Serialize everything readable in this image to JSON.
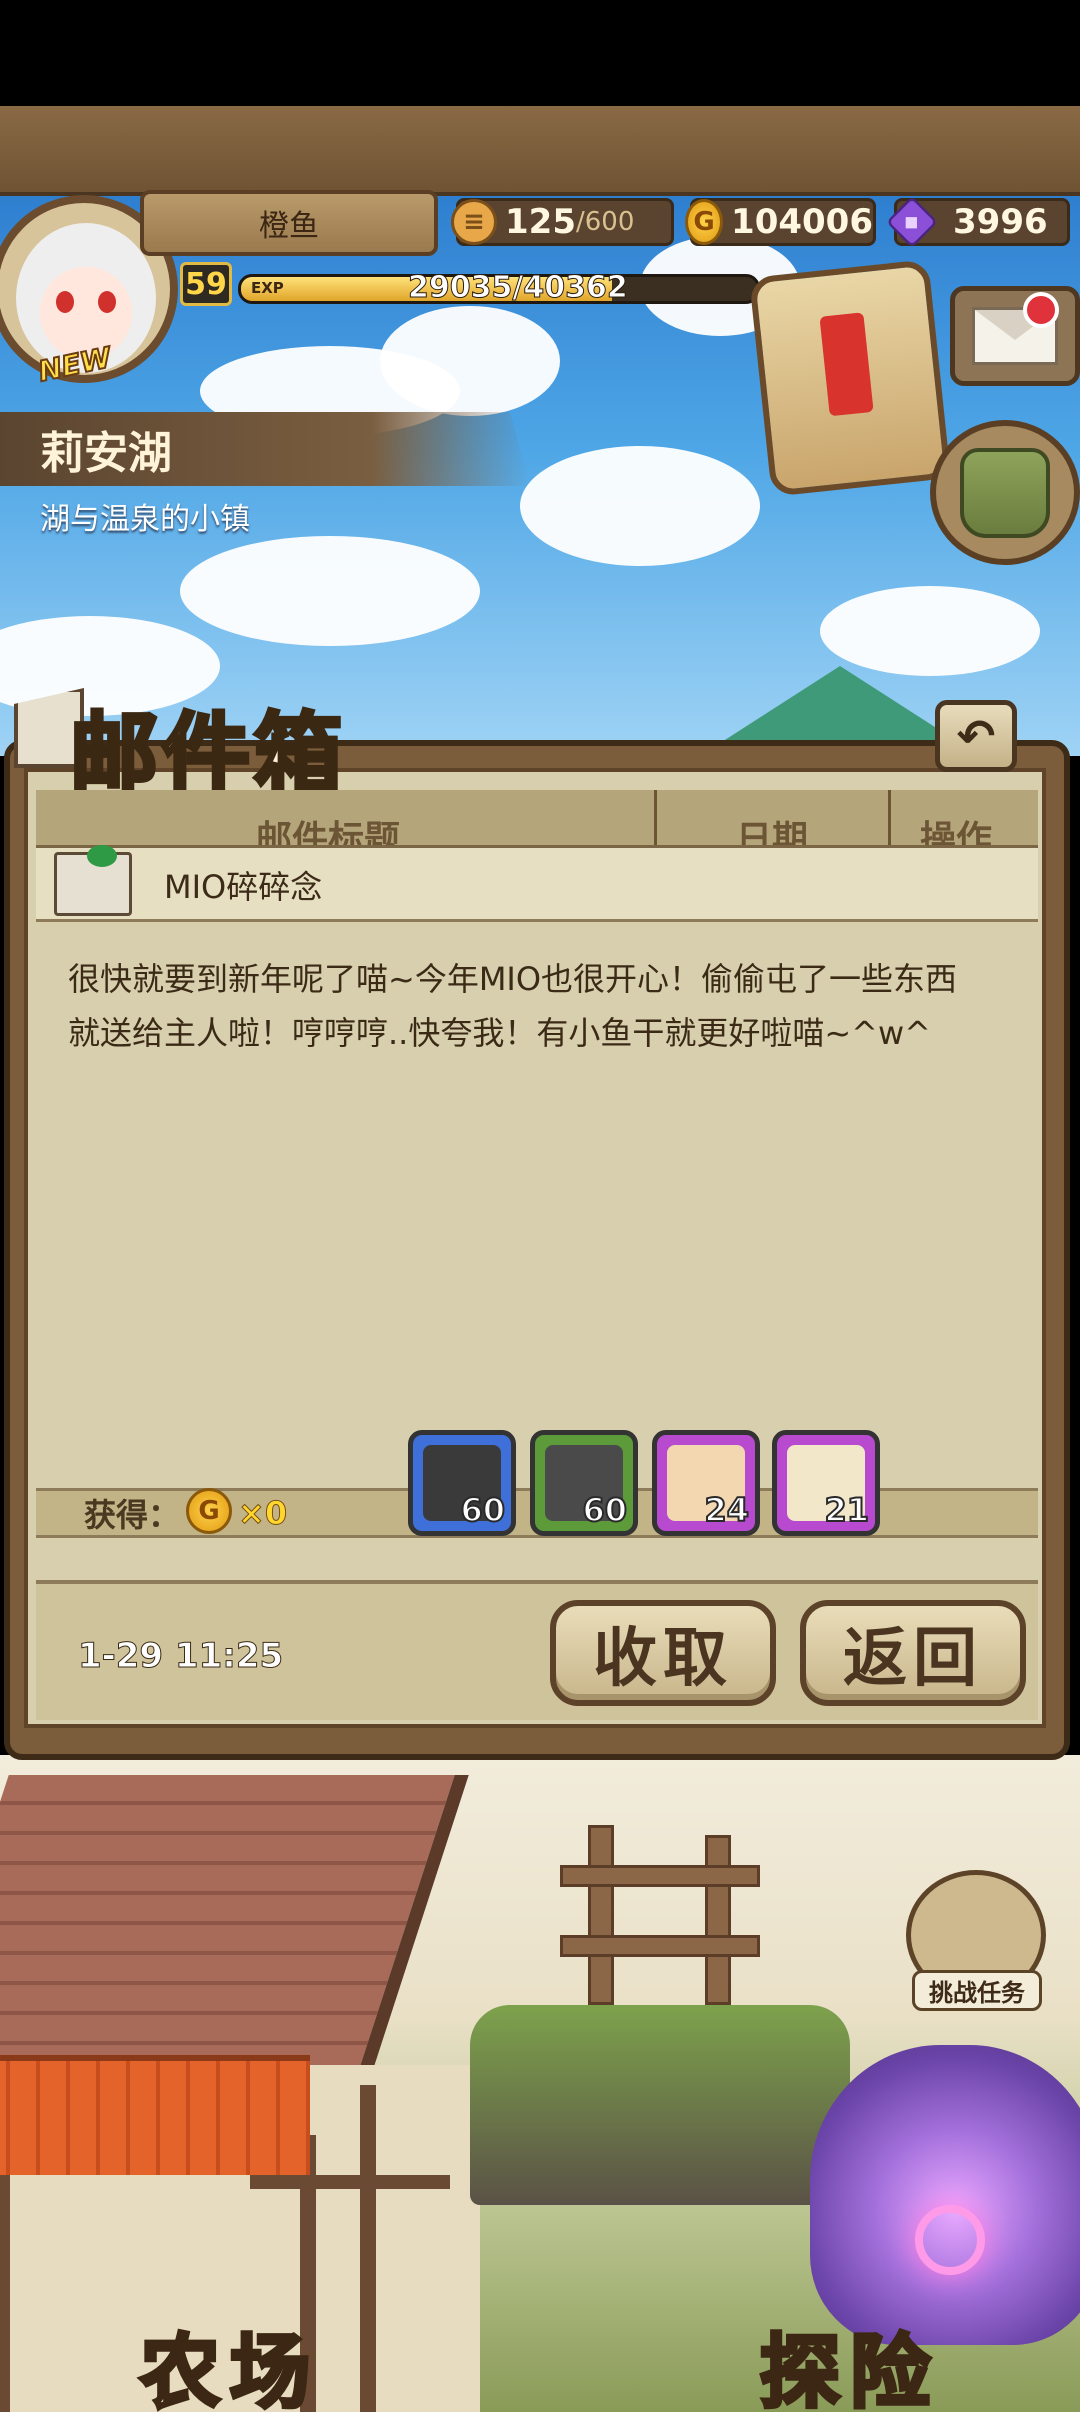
{
  "player": {
    "name": "橙鱼",
    "level": "59",
    "exp_label": "EXP",
    "exp_text": "29035/40362",
    "exp_fraction": 0.7194,
    "new_tag": "NEW"
  },
  "resources": {
    "stamina_value": "125",
    "stamina_max": "/600",
    "gold": "104006",
    "gems": "3996"
  },
  "location": {
    "name": "莉安湖",
    "subtitle": "湖与温泉的小镇"
  },
  "mailbox": {
    "title": "邮件箱",
    "back_icon": "↶",
    "columns": [
      "邮件标题",
      "日期",
      "操作"
    ],
    "mail": {
      "subject": "MIO碎碎念",
      "body_lines": [
        "很快就要到新年呢了喵~今年MIO也很开心！偷偷屯了一些东西",
        "就送给主人啦！哼哼哼..快夸我！有小鱼干就更好啦喵~^w^"
      ],
      "reward_label": "获得：",
      "coin_symbol": "G",
      "coin_count": "×0",
      "items": [
        {
          "count": "60",
          "border": "#3f6fd8",
          "art": "#3a3a3a"
        },
        {
          "count": "60",
          "border": "#5c9a3a",
          "art": "#4a4a4a"
        },
        {
          "count": "24",
          "border": "#b84ad0",
          "art": "#f3d7b0"
        },
        {
          "count": "21",
          "border": "#b84ad0",
          "art": "#f3e7c9"
        }
      ],
      "date": "1-29 11:25"
    },
    "collect_label": "收取",
    "return_label": "返回"
  },
  "bottom": {
    "challenge_label": "挑战任务",
    "farm_label": "农场",
    "explore_label": "探险"
  },
  "colors": {
    "sky": "#4ea6e6",
    "panel": "#d7cfae",
    "wood": "#7b5c3b"
  }
}
